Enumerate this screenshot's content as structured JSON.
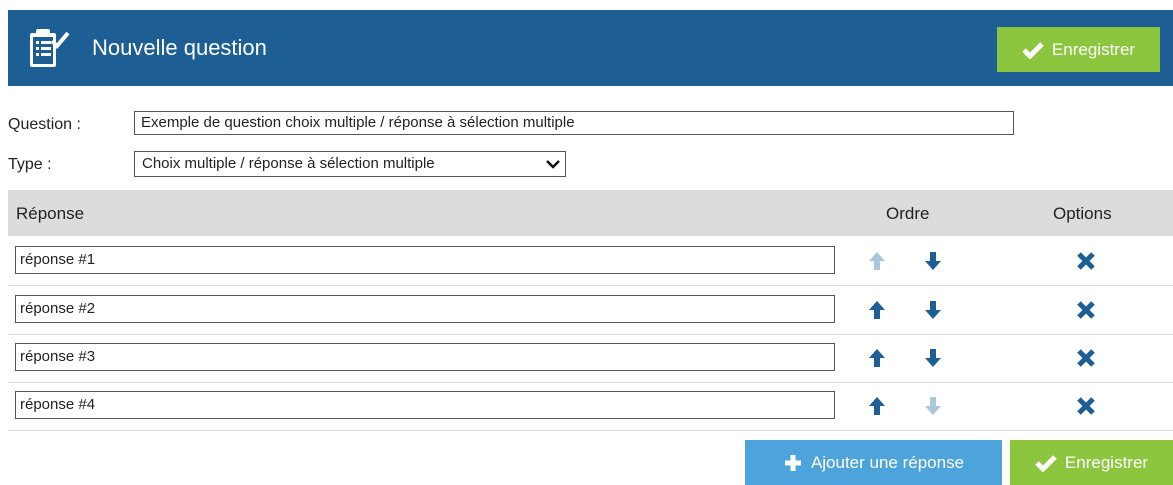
{
  "header": {
    "title": "Nouvelle question",
    "icon": "clipboard-check-icon",
    "save_label": "Enregistrer"
  },
  "form": {
    "question_label": "Question :",
    "question_value": "Exemple de question choix multiple / réponse à sélection multiple",
    "type_label": "Type :",
    "type_value": "Choix multiple / réponse à sélection multiple"
  },
  "grid": {
    "col_answer": "Réponse",
    "col_order": "Ordre",
    "col_options": "Options",
    "rows": [
      {
        "value": "réponse #1",
        "up_enabled": false,
        "down_enabled": true
      },
      {
        "value": "réponse #2",
        "up_enabled": true,
        "down_enabled": true
      },
      {
        "value": "réponse #3",
        "up_enabled": true,
        "down_enabled": true
      },
      {
        "value": "réponse #4",
        "up_enabled": true,
        "down_enabled": false
      }
    ]
  },
  "footer": {
    "add_label": "Ajouter une réponse",
    "save_label": "Enregistrer"
  },
  "colors": {
    "header_bg": "#1d5e94",
    "green": "#8cc63f",
    "blue": "#4da3dc",
    "arrow_active": "#1d5e94",
    "arrow_disabled": "#a9c8dd"
  }
}
